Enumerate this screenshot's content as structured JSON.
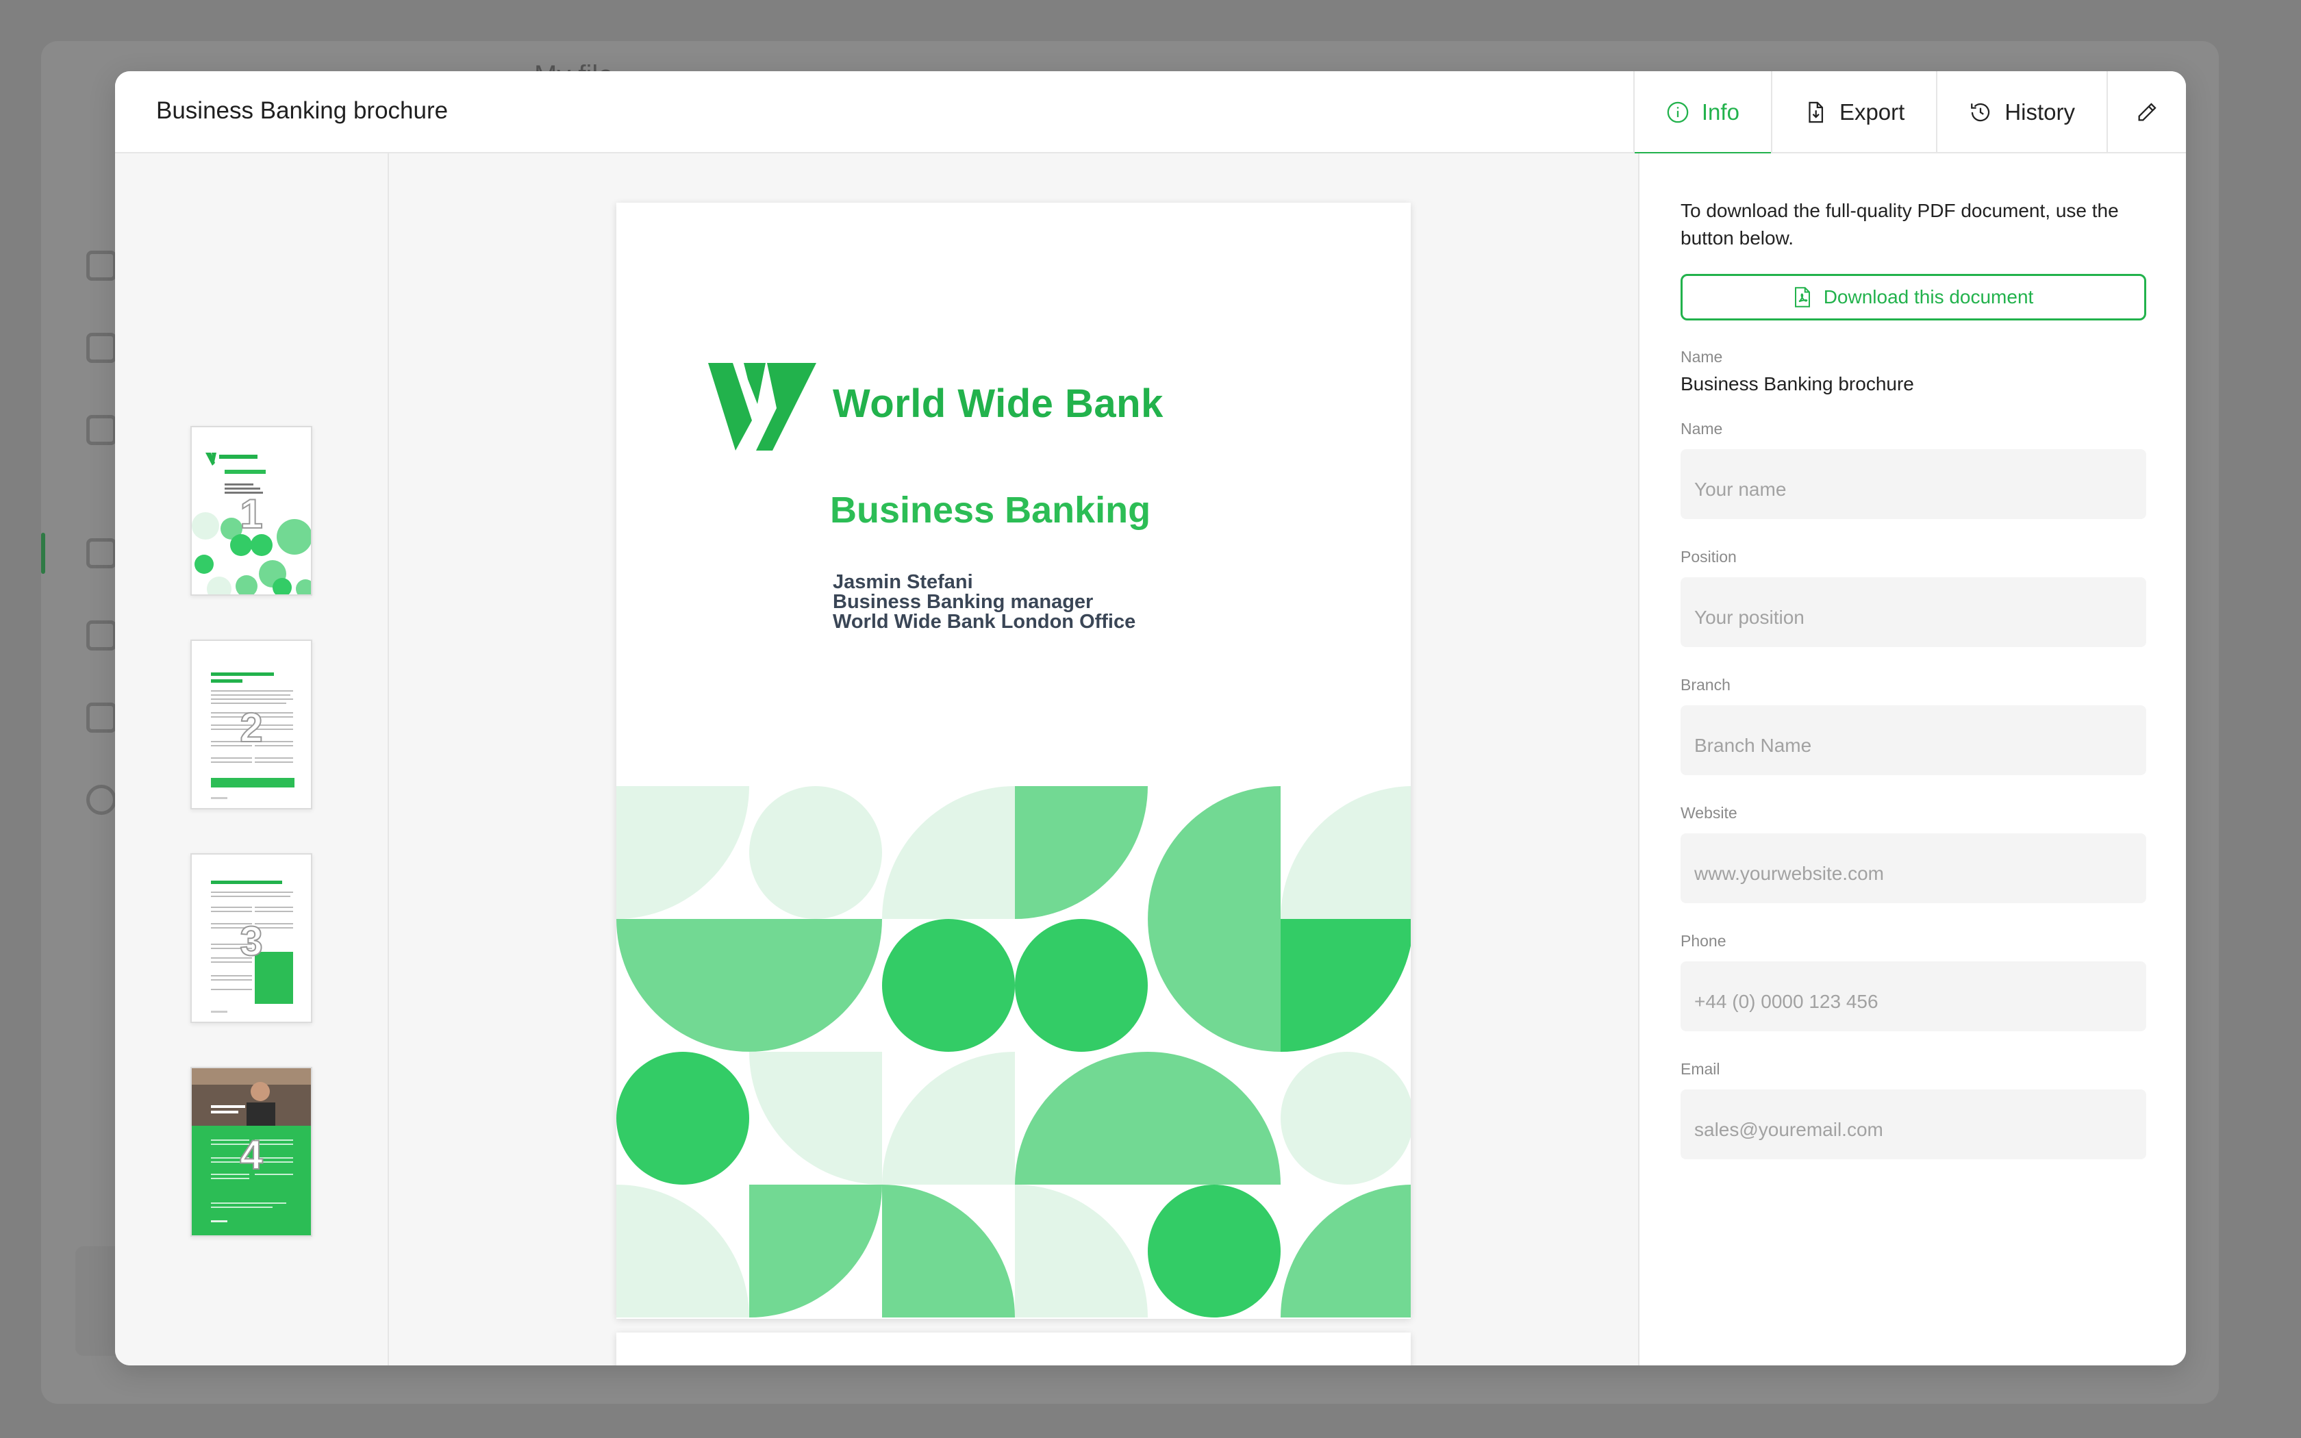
{
  "background_app": {
    "toolbar_text": "My file"
  },
  "modal": {
    "title": "Business Banking brochure",
    "tabs": [
      {
        "label": "Info",
        "icon": "info-icon",
        "active": true
      },
      {
        "label": "Export",
        "icon": "export-icon",
        "active": false
      },
      {
        "label": "History",
        "icon": "history-icon",
        "active": false
      }
    ],
    "edit_icon": "pencil-icon"
  },
  "thumbnails": [
    {
      "page": "1"
    },
    {
      "page": "2"
    },
    {
      "page": "3"
    },
    {
      "page": "4"
    }
  ],
  "document": {
    "bank_name": "World Wide Bank",
    "heading": "Business Banking",
    "contact_name": "Jasmin Stefani",
    "contact_role": "Business Banking manager",
    "contact_office": "World Wide Bank London Office",
    "colors": {
      "brand_green": "#22b24c",
      "mid_green": "#72d993",
      "light_green": "#e2f5e8",
      "bright_green": "#33cc66"
    }
  },
  "info_panel": {
    "intro": "To download the full-quality PDF document, use the button below.",
    "download_label": "Download this document",
    "doc_name_label": "Name",
    "doc_name_value": "Business Banking brochure",
    "fields": [
      {
        "label": "Name",
        "placeholder": "Your name"
      },
      {
        "label": "Position",
        "placeholder": "Your position"
      },
      {
        "label": "Branch",
        "placeholder": "Branch Name"
      },
      {
        "label": "Website",
        "placeholder": "www.yourwebsite.com"
      },
      {
        "label": "Phone",
        "placeholder": "+44 (0) 0000 123 456"
      },
      {
        "label": "Email",
        "placeholder": "sales@youremail.com"
      }
    ]
  }
}
